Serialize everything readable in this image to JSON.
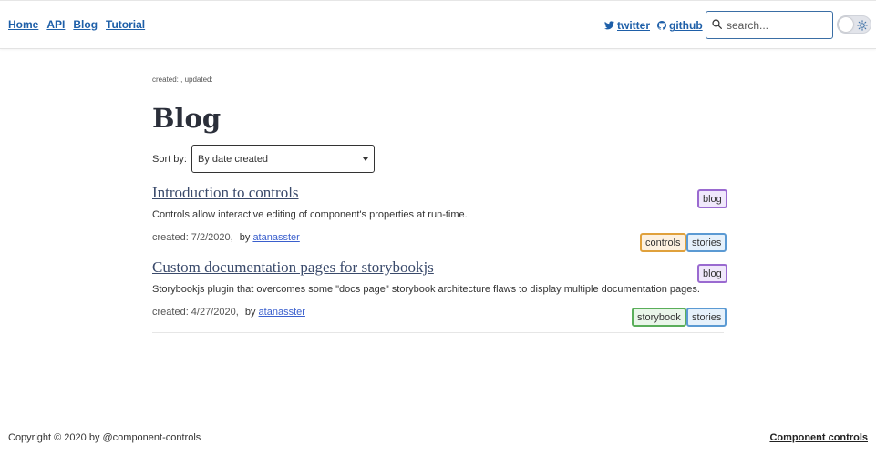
{
  "nav": {
    "links": [
      "Home",
      "API",
      "Blog",
      "Tutorial"
    ],
    "twitter": "twitter",
    "github": "github",
    "search_placeholder": "search..."
  },
  "icons": {
    "twitter": "twitter-icon",
    "github": "github-icon",
    "search": "search-icon",
    "theme": "sun-icon"
  },
  "colors": {
    "link": "#1e5fa8",
    "tag_blog": "#9a6ad0",
    "tag_controls": "#e0a13c",
    "tag_stories": "#5b9ad3",
    "tag_storybook": "#5aae5a"
  },
  "main": {
    "meta": "created: , updated:",
    "title": "Blog",
    "sort_label": "Sort by:",
    "sort_value": "By date created"
  },
  "posts": [
    {
      "title": "Introduction to controls",
      "description": "Controls allow interactive editing of component's properties at run-time.",
      "created": "created: 7/2/2020,",
      "by": "by",
      "author": "atanasster",
      "category": "blog",
      "tags": [
        "controls",
        "stories"
      ]
    },
    {
      "title": "Custom documentation pages for storybookjs",
      "description": "Storybookjs plugin that overcomes some \"docs page\" storybook architecture flaws to display multiple documentation pages.",
      "created": "created: 4/27/2020,",
      "by": "by",
      "author": "atanasster",
      "category": "blog",
      "tags": [
        "storybook",
        "stories"
      ]
    }
  ],
  "footer": {
    "copyright": "Copyright © 2020 by @component-controls",
    "brand": "Component controls"
  }
}
